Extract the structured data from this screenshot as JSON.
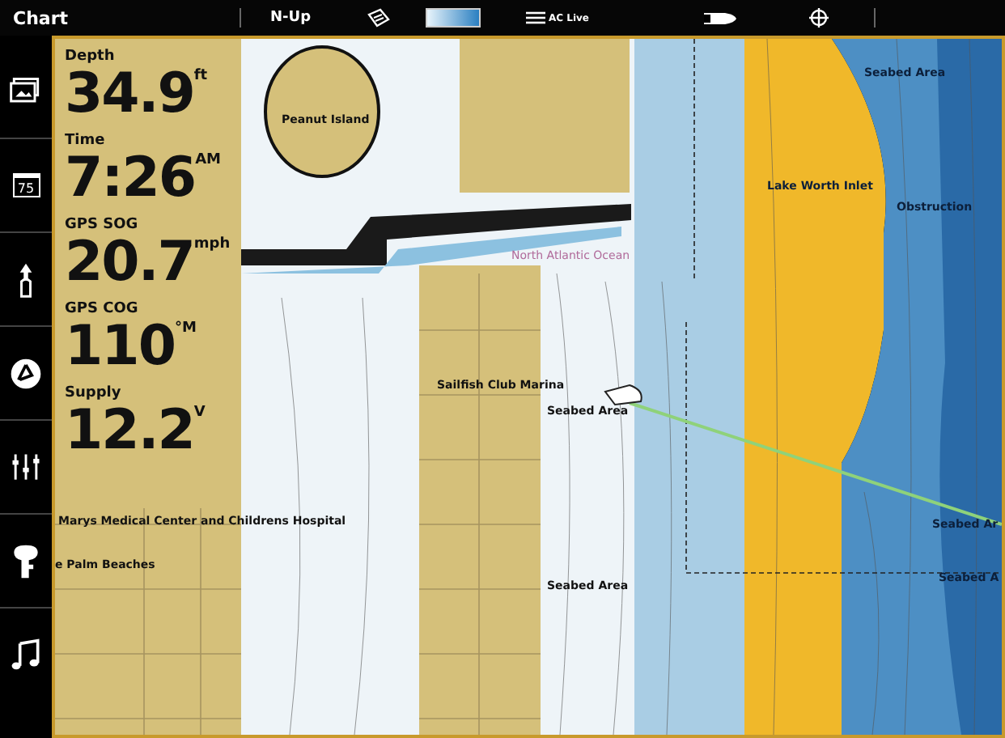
{
  "top_bar": {
    "title": "Chart",
    "orientation": "N-Up",
    "live_label": "AC Live"
  },
  "sidebar": {
    "items": [
      {
        "kind": "images"
      },
      {
        "kind": "temperature",
        "text": "75"
      },
      {
        "kind": "navigation"
      },
      {
        "kind": "waypoints"
      },
      {
        "kind": "mixer"
      },
      {
        "kind": "motor"
      },
      {
        "kind": "music"
      }
    ]
  },
  "data_overlay": [
    {
      "label": "Depth",
      "value": "34.9",
      "unit": "ft"
    },
    {
      "label": "Time",
      "value": "7:26",
      "unit": "AM"
    },
    {
      "label": "GPS SOG",
      "value": "20.7",
      "unit": "mph"
    },
    {
      "label": "GPS COG",
      "value": "110",
      "unit": "°M"
    },
    {
      "label": "Supply",
      "value": "12.2",
      "unit": "V"
    }
  ],
  "map_labels": [
    {
      "text": "Peanut Island",
      "kind": "land"
    },
    {
      "text": "Seabed Area",
      "kind": "sea"
    },
    {
      "text": "Lake Worth Inlet",
      "kind": "sea"
    },
    {
      "text": "Obstruction",
      "kind": "sea"
    },
    {
      "text": "North Atlantic Ocean",
      "kind": "faint"
    },
    {
      "text": "Sailfish Club Marina",
      "kind": "land"
    },
    {
      "text": "Seabed Area",
      "kind": "land"
    },
    {
      "text": "Marys Medical Center and Childrens Hospital",
      "kind": "land"
    },
    {
      "text": "e Palm Beaches",
      "kind": "land"
    },
    {
      "text": "Seabed Area",
      "kind": "land"
    },
    {
      "text": "Seabed Ar",
      "kind": "sea"
    },
    {
      "text": "Seabed A",
      "kind": "sea"
    }
  ]
}
